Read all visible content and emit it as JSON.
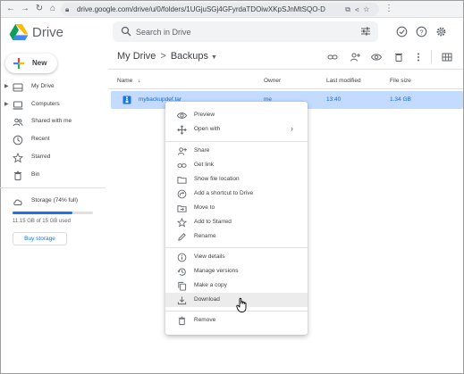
{
  "browser": {
    "url": "drive.google.com/drive/u/0/folders/1UGjuSGj4GFyrdaTDOiwXKpSJnMtSQO-D",
    "back_label": "←",
    "forward_label": "→",
    "reload_label": "↻"
  },
  "app": {
    "name": "Drive"
  },
  "search": {
    "placeholder": "Search in Drive"
  },
  "new_button": {
    "label": "New"
  },
  "sidebar": {
    "items": [
      {
        "label": "My Drive",
        "icon": "my-drive-icon"
      },
      {
        "label": "Computers",
        "icon": "computers-icon"
      },
      {
        "label": "Shared with me",
        "icon": "shared-icon"
      },
      {
        "label": "Recent",
        "icon": "clock-icon"
      },
      {
        "label": "Starred",
        "icon": "star-icon"
      },
      {
        "label": "Bin",
        "icon": "bin-icon"
      }
    ],
    "storage": {
      "label": "Storage (74% full)",
      "used_fraction": 0.74,
      "detail": "11.15 GB of 15 GB used",
      "buy_label": "Buy storage"
    }
  },
  "breadcrumb": {
    "root": "My Drive",
    "separator": ">",
    "current": "Backups"
  },
  "table": {
    "columns": {
      "name": "Name",
      "owner": "Owner",
      "modified": "Last modified",
      "size": "File size"
    },
    "sort_indicator": "↓",
    "rows": [
      {
        "name": "mybackupdef.tar",
        "owner": "me",
        "modified": "13:40",
        "size": "1.34 GB"
      }
    ]
  },
  "context_menu": {
    "items": [
      {
        "label": "Preview",
        "icon": "eye-icon"
      },
      {
        "label": "Open with",
        "icon": "open-with-icon",
        "submenu": true
      },
      {
        "label": "Share",
        "icon": "share-icon"
      },
      {
        "label": "Get link",
        "icon": "link-icon"
      },
      {
        "label": "Show file location",
        "icon": "folder-icon"
      },
      {
        "label": "Add a shortcut to Drive",
        "icon": "shortcut-icon"
      },
      {
        "label": "Move to",
        "icon": "move-icon"
      },
      {
        "label": "Add to Starred",
        "icon": "star-icon"
      },
      {
        "label": "Rename",
        "icon": "pencil-icon"
      },
      {
        "label": "View details",
        "icon": "info-icon"
      },
      {
        "label": "Manage versions",
        "icon": "history-icon"
      },
      {
        "label": "Make a copy",
        "icon": "copy-icon"
      },
      {
        "label": "Download",
        "icon": "download-icon",
        "hovered": true
      },
      {
        "label": "Remove",
        "icon": "trash-icon"
      }
    ],
    "submenu_arrow": "›"
  },
  "colors": {
    "accent": "#1a73e8",
    "selected_row": "#c2dbff",
    "hover_item": "#ececec"
  }
}
